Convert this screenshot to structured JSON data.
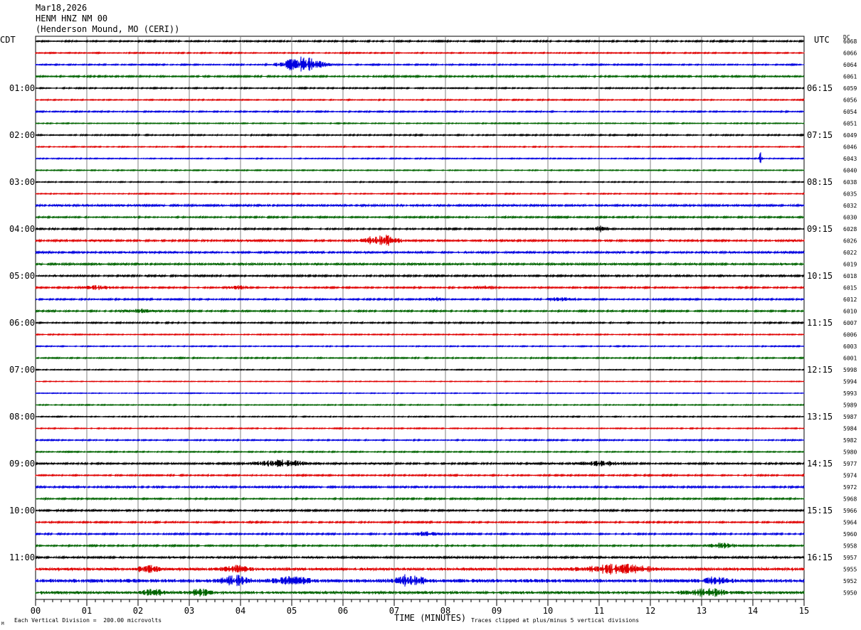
{
  "header": {
    "date": "Mar18,2026",
    "station": "HENM HNZ NM 00",
    "location": "(Henderson Mound, MO (CERI))"
  },
  "left_tz": "CDT",
  "right_tz": "UTC",
  "dc_label": "DC",
  "footer": {
    "scale": "Each Vertical Division =  200.00 microvolts",
    "xlabel": "TIME (MINUTES)",
    "clip_note": "Traces clipped at plus/minus 5 vertical divisions",
    "corner_mark": "M"
  },
  "colors": {
    "cycle": [
      "#000000",
      "#e00000",
      "#0000e0",
      "#006400"
    ],
    "grid": "#808080"
  },
  "chart_data": {
    "type": "line",
    "title": "HENM HNZ NM 00",
    "xlabel": "TIME (MINUTES)",
    "xlim": [
      0,
      15
    ],
    "x_ticks": [
      "00",
      "01",
      "02",
      "03",
      "04",
      "05",
      "06",
      "07",
      "08",
      "09",
      "10",
      "11",
      "12",
      "13",
      "14",
      "15"
    ],
    "trace_count": 48,
    "left_hour_labels": [
      "01:00",
      "02:00",
      "03:00",
      "04:00",
      "05:00",
      "06:00",
      "07:00",
      "08:00",
      "09:00",
      "10:00",
      "11:00"
    ],
    "right_hour_labels": [
      "06:15",
      "07:15",
      "08:15",
      "09:15",
      "10:15",
      "11:15",
      "12:15",
      "13:15",
      "14:15",
      "15:15",
      "16:15"
    ],
    "dc_offsets": [
      "6068",
      "6066",
      "6064",
      "6061",
      "6059",
      "6056",
      "6054",
      "6051",
      "6049",
      "6046",
      "6043",
      "6040",
      "6038",
      "6035",
      "6032",
      "6030",
      "6028",
      "6026",
      "6022",
      "6019",
      "6018",
      "6015",
      "6012",
      "6010",
      "6007",
      "6006",
      "6003",
      "6001",
      "5998",
      "5994",
      "5993",
      "5989",
      "5987",
      "5984",
      "5982",
      "5980",
      "5977",
      "5974",
      "5972",
      "5968",
      "5966",
      "5964",
      "5960",
      "5958",
      "5957",
      "5955",
      "5952",
      "5950"
    ],
    "noise_levels": [
      1.2,
      0.9,
      1.0,
      1.3,
      1.0,
      0.9,
      1.0,
      0.8,
      1.0,
      0.8,
      0.8,
      0.8,
      0.8,
      0.8,
      1.6,
      1.2,
      1.3,
      1.5,
      1.5,
      1.6,
      1.4,
      1.2,
      1.2,
      1.2,
      1.1,
      0.8,
      0.8,
      1.0,
      0.7,
      0.6,
      0.6,
      0.8,
      0.8,
      0.8,
      1.0,
      0.9,
      1.4,
      1.1,
      1.5,
      1.2,
      1.4,
      1.2,
      1.2,
      1.2,
      1.6,
      2.2,
      3.0,
      2.2
    ],
    "events": [
      {
        "trace": 2,
        "minute": 5.2,
        "amplitude": 12,
        "duration": 0.6
      },
      {
        "trace": 10,
        "minute": 14.15,
        "amplitude": 10,
        "duration": 0.05
      },
      {
        "trace": 17,
        "minute": 6.75,
        "amplitude": 9,
        "duration": 0.5
      },
      {
        "trace": 16,
        "minute": 11.05,
        "amplitude": 5,
        "duration": 0.2
      },
      {
        "trace": 21,
        "minute": 1.2,
        "amplitude": 3,
        "duration": 0.4
      },
      {
        "trace": 21,
        "minute": 3.95,
        "amplitude": 3,
        "duration": 0.3
      },
      {
        "trace": 21,
        "minute": 8.8,
        "amplitude": 2.5,
        "duration": 0.3
      },
      {
        "trace": 22,
        "minute": 7.8,
        "amplitude": 3,
        "duration": 0.2
      },
      {
        "trace": 22,
        "minute": 10.25,
        "amplitude": 3.5,
        "duration": 0.3
      },
      {
        "trace": 23,
        "minute": 2.0,
        "amplitude": 3,
        "duration": 0.4
      },
      {
        "trace": 36,
        "minute": 4.8,
        "amplitude": 5,
        "duration": 0.8
      },
      {
        "trace": 36,
        "minute": 11.0,
        "amplitude": 4,
        "duration": 0.6
      },
      {
        "trace": 42,
        "minute": 7.6,
        "amplitude": 3,
        "duration": 0.4
      },
      {
        "trace": 43,
        "minute": 13.4,
        "amplitude": 4,
        "duration": 0.4
      },
      {
        "trace": 45,
        "minute": 2.2,
        "amplitude": 6,
        "duration": 0.3
      },
      {
        "trace": 45,
        "minute": 3.9,
        "amplitude": 5,
        "duration": 0.4
      },
      {
        "trace": 45,
        "minute": 11.4,
        "amplitude": 7,
        "duration": 1.0
      },
      {
        "trace": 46,
        "minute": 3.9,
        "amplitude": 7,
        "duration": 0.4
      },
      {
        "trace": 46,
        "minute": 7.3,
        "amplitude": 9,
        "duration": 0.4
      },
      {
        "trace": 46,
        "minute": 5.0,
        "amplitude": 5,
        "duration": 0.5
      },
      {
        "trace": 46,
        "minute": 13.3,
        "amplitude": 6,
        "duration": 0.3
      },
      {
        "trace": 47,
        "minute": 2.3,
        "amplitude": 5,
        "duration": 0.3
      },
      {
        "trace": 47,
        "minute": 3.2,
        "amplitude": 5,
        "duration": 0.3
      },
      {
        "trace": 47,
        "minute": 13.1,
        "amplitude": 6,
        "duration": 0.6
      }
    ]
  }
}
